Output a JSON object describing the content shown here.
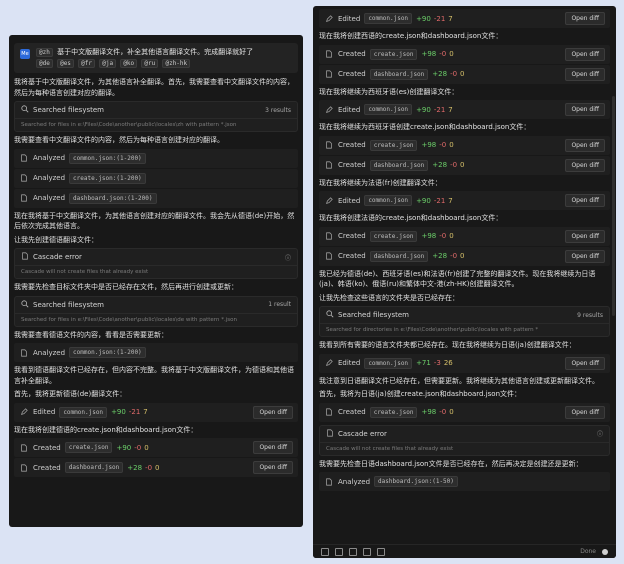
{
  "left": {
    "prompt_avatar": "Me",
    "prompt_prefix_chip": "@zh",
    "prompt_text": "基于中文版翻译文件，补全其他语言翻译文件。完成翻译就好了",
    "prompt_chips": [
      "@de",
      "@es",
      "@fr",
      "@ja",
      "@ko",
      "@ru",
      "@zh-hk"
    ],
    "msg1": "我将基于中文版翻译文件，为其他语言补全翻译。首先，我需要查看中文翻译文件的内容，然后为每种语言创建对应的翻译。",
    "search1": {
      "title": "Searched filesystem",
      "result": "3 results",
      "sub": "Searched for files in e:\\Files\\Code\\another\\public\\locales\\zh with pattern *.json"
    },
    "msg2": "我需要查看中文翻译文件的内容，然后为每种语言创建对应的翻译。",
    "analyzed": [
      {
        "label": "Analyzed",
        "file": "common.json:(1-200)"
      },
      {
        "label": "Analyzed",
        "file": "create.json:(1-200)"
      },
      {
        "label": "Analyzed",
        "file": "dashboard.json:(1-200)"
      }
    ],
    "msg3": "现在我将基于中文翻译文件，为其他语言创建对应的翻译文件。我会先从德语(de)开始，然后依次完成其他语言。",
    "msg3b": "让我先创建德语翻译文件：",
    "error": {
      "title": "Cascade error",
      "sub": "Cascade will not create files that already exist"
    },
    "msg4": "我需要先检查目标文件夹中是否已经存在文件，然后再进行创建或更新：",
    "search2": {
      "title": "Searched filesystem",
      "result": "1 result",
      "sub": "Searched for files in e:\\Files\\Code\\another\\public\\locales\\de with pattern *.json"
    },
    "msg5": "我需要查看德语文件的内容，看看是否需要更新：",
    "analyzed2": {
      "label": "Analyzed",
      "file": "common.json:(1-200)"
    },
    "msg6": "我看到德语翻译文件已经存在，但内容不完整。我将基于中文版翻译文件，为德语和其他语言补全翻译。",
    "msg6b": "首先，我将更新德语(de)翻译文件：",
    "edited": {
      "label": "Edited",
      "file": "common.json",
      "plus": "+90",
      "minus": "-21",
      "num": "7",
      "btn": "Open diff"
    },
    "msg7": "现在我将创建德语的create.json和dashboard.json文件：",
    "created": [
      {
        "label": "Created",
        "file": "create.json",
        "plus": "+90",
        "minus": "-0",
        "num": "0",
        "btn": "Open diff"
      },
      {
        "label": "Created",
        "file": "dashboard.json",
        "plus": "+28",
        "minus": "-0",
        "num": "0",
        "btn": "Open diff"
      }
    ]
  },
  "right": {
    "edited_top": {
      "label": "Edited",
      "file": "common.json",
      "plus": "+90",
      "minus": "-21",
      "num": "7",
      "btn": "Open diff"
    },
    "msg_es": "现在我将创建西语的create.json和dashboard.json文件：",
    "es_created": [
      {
        "label": "Created",
        "file": "create.json",
        "plus": "+98",
        "minus": "-0",
        "num": "0",
        "btn": "Open diff"
      },
      {
        "label": "Created",
        "file": "dashboard.json",
        "plus": "+28",
        "minus": "-0",
        "num": "0",
        "btn": "Open diff"
      }
    ],
    "msg_es2": "现在我将继续为西班牙语(es)创建翻译文件：",
    "es_edit": {
      "label": "Edited",
      "file": "common.json",
      "plus": "+90",
      "minus": "-21",
      "num": "7",
      "btn": "Open diff"
    },
    "msg_es3": "现在我将继续为西班牙语创建create.json和dashboard.json文件：",
    "es_created2": [
      {
        "label": "Created",
        "file": "create.json",
        "plus": "+98",
        "minus": "-0",
        "num": "0",
        "btn": "Open diff"
      },
      {
        "label": "Created",
        "file": "dashboard.json",
        "plus": "+28",
        "minus": "-0",
        "num": "0",
        "btn": "Open diff"
      }
    ],
    "msg_fr": "现在我将继续为法语(fr)创建翻译文件：",
    "fr_edit": {
      "label": "Edited",
      "file": "common.json",
      "plus": "+90",
      "minus": "-21",
      "num": "7",
      "btn": "Open diff"
    },
    "msg_fr2": "现在我将创建法语的create.json和dashboard.json文件：",
    "fr_created": [
      {
        "label": "Created",
        "file": "create.json",
        "plus": "+98",
        "minus": "-0",
        "num": "0",
        "btn": "Open diff"
      },
      {
        "label": "Created",
        "file": "dashboard.json",
        "plus": "+28",
        "minus": "-0",
        "num": "0",
        "btn": "Open diff"
      }
    ],
    "msg_done": "我已经为德语(de)、西班牙语(es)和法语(fr)创建了完整的翻译文件。现在我将继续为日语(ja)、韩语(ko)、俄语(ru)和繁体中文-港(zh-HK)创建翻译文件。",
    "msg_check": "让我先检查这些语言的文件夹是否已经存在：",
    "search": {
      "title": "Searched filesystem",
      "result": "9 results",
      "sub": "Searched for directories in e:\\Files\\Code\\another\\public\\locales with pattern *"
    },
    "msg_ja": "我看到所有需要的语言文件夹都已经存在。现在我将继续为日语(ja)创建翻译文件：",
    "ja_edit": {
      "label": "Edited",
      "file": "common.json",
      "plus": "+71",
      "minus": "-3",
      "num": "26",
      "btn": "Open diff"
    },
    "msg_ja2": "我注意到日语翻译文件已经存在，但需要更新。我将继续为其他语言创建或更新翻译文件。",
    "msg_ja3": "首先，我将为日语(ja)创建create.json和dashboard.json文件：",
    "ja_created": {
      "label": "Created",
      "file": "create.json",
      "plus": "+98",
      "minus": "-0",
      "num": "0",
      "btn": "Open diff"
    },
    "error": {
      "title": "Cascade error",
      "sub": "Cascade will not create files that already exist"
    },
    "msg_last": "我需要先检查日语dashboard.json文件是否已经存在，然后再决定是创建还是更新：",
    "analyzed": {
      "label": "Analyzed",
      "file": "dashboard.json:(1-50)"
    },
    "footer_done": "Done"
  }
}
